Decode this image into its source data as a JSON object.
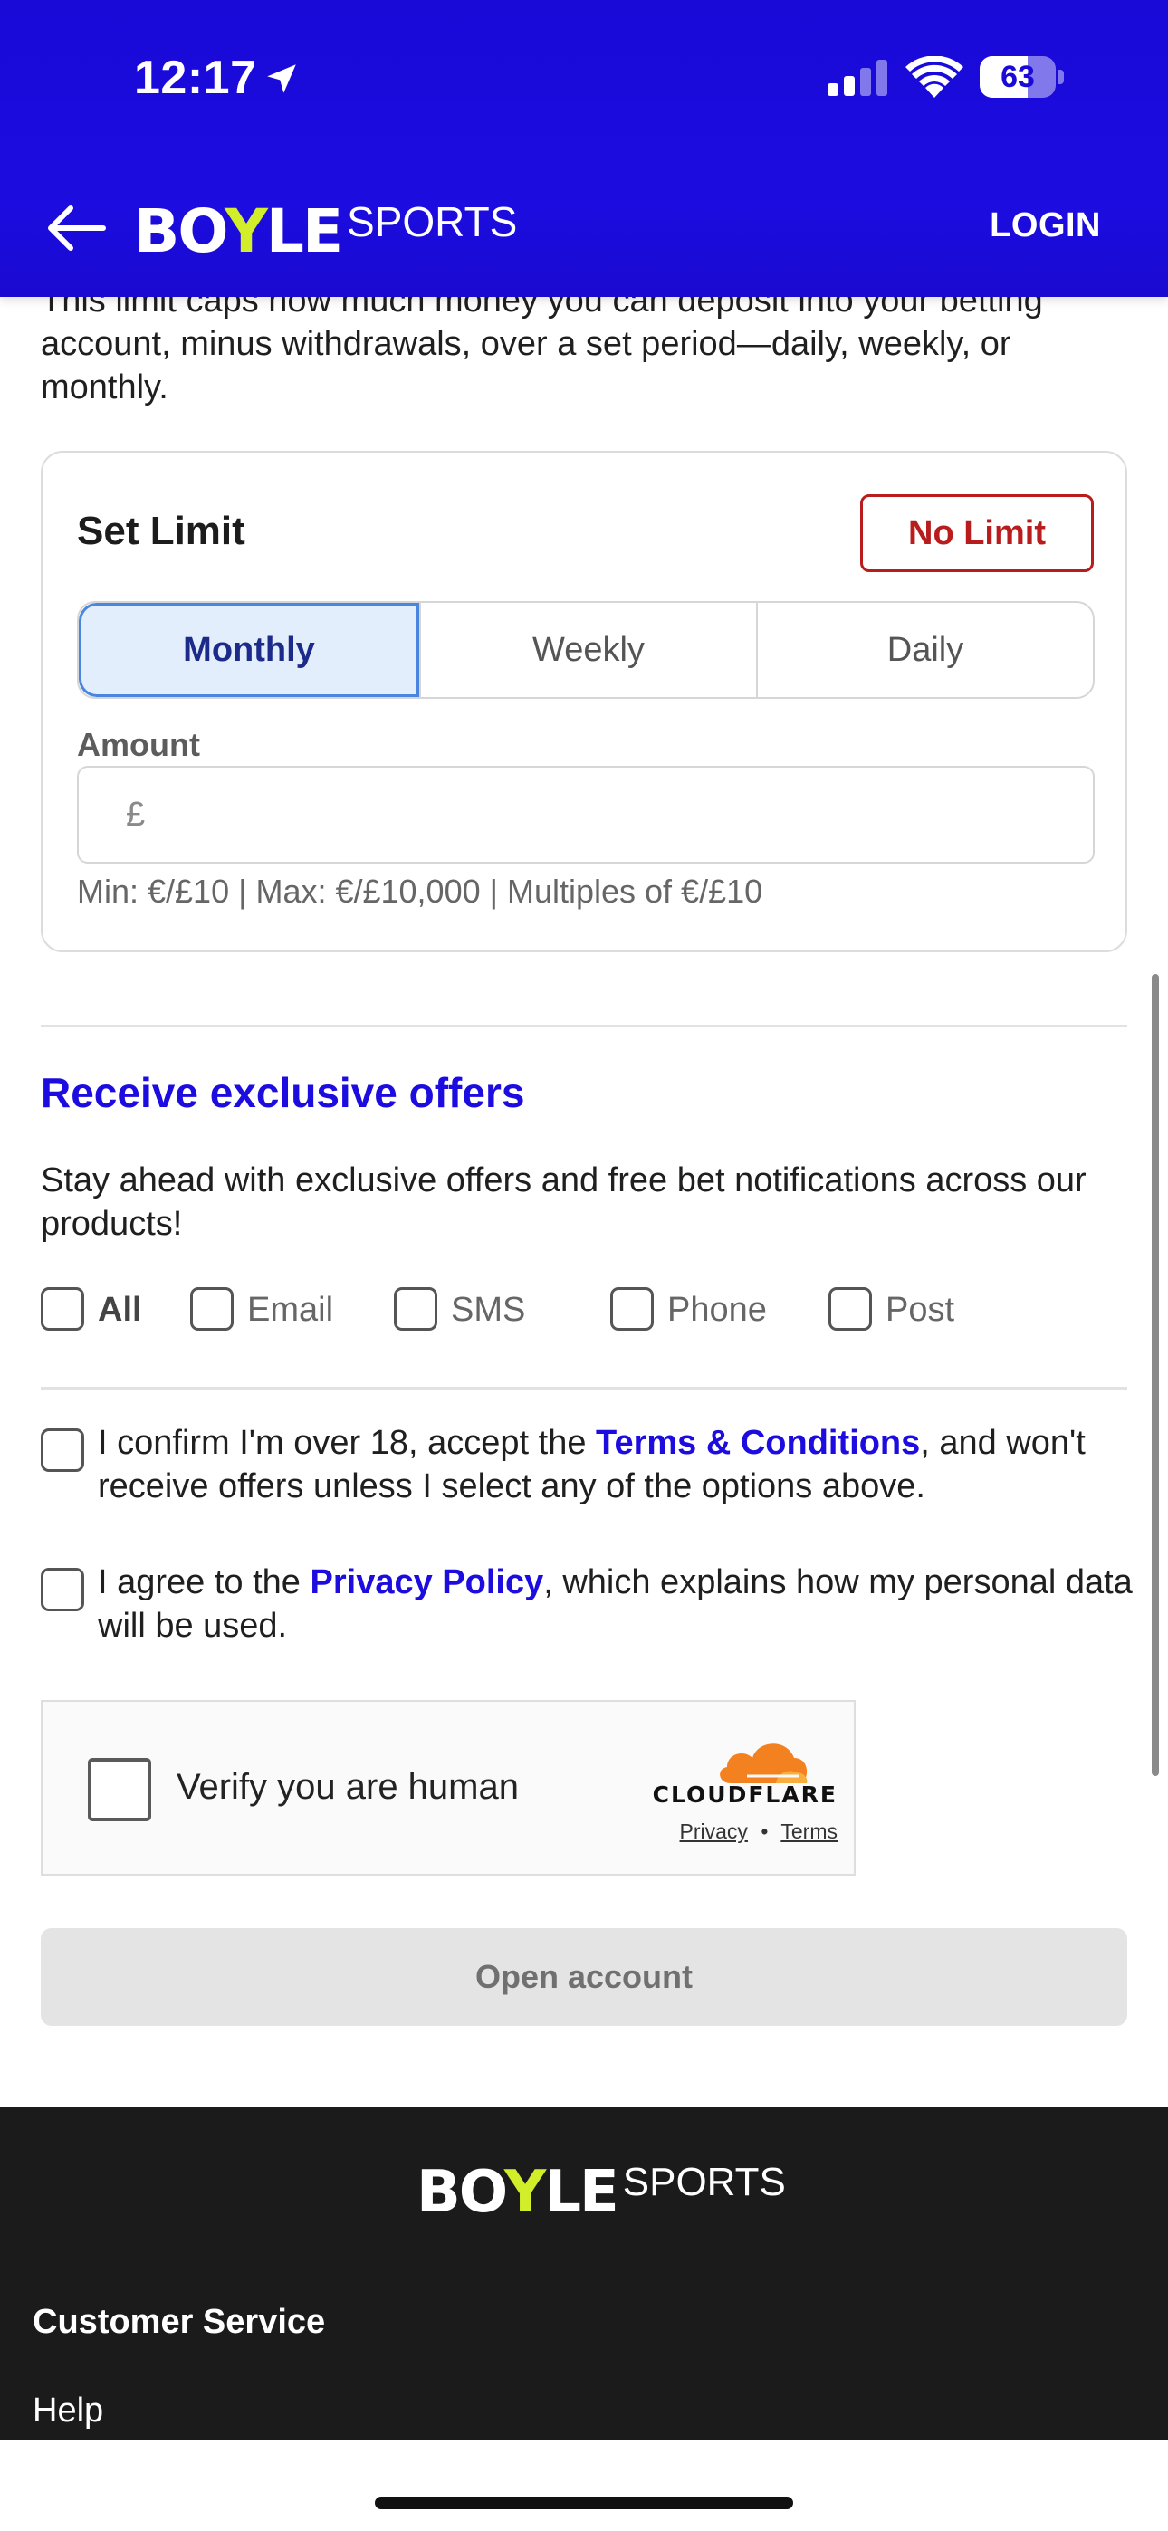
{
  "status_bar": {
    "time": "12:17",
    "battery_percent": "63",
    "battery_level": 0.63,
    "signal_bars": 4,
    "signal_active_bars": 2
  },
  "header": {
    "brand_main": "BOYLE",
    "brand_sub": "SPORTS",
    "login_label": "LOGIN",
    "bg_color": "#1c0cdf",
    "accent_color": "#d2ed2a"
  },
  "intro_text": "This limit caps how much money you can deposit into your betting account, minus withdrawals, over a set period—daily, weekly, or monthly.",
  "limit_card": {
    "title": "Set Limit",
    "no_limit_label": "No Limit",
    "periods": [
      "Monthly",
      "Weekly",
      "Daily"
    ],
    "selected_period": "Monthly",
    "amount_label": "Amount",
    "currency_symbol": "£",
    "amount_value": "",
    "hint": "Min: €/£10 | Max: €/£10,000 | Multiples of €/£10"
  },
  "offers": {
    "title": "Receive exclusive offers",
    "text": "Stay ahead with exclusive offers and free bet notifications across our products!",
    "options": [
      "All",
      "Email",
      "SMS",
      "Phone",
      "Post"
    ]
  },
  "consent": {
    "age_prefix": "I confirm I'm over 18, accept the ",
    "age_link": "Terms & Conditions",
    "age_suffix": ", and won't receive offers unless I select any of the options above.",
    "privacy_prefix": "I agree to the ",
    "privacy_link": "Privacy Policy",
    "privacy_suffix": ", which explains how my personal data will be used."
  },
  "captcha": {
    "label": "Verify you are human",
    "provider": "CLOUDFLARE",
    "privacy_link": "Privacy",
    "separator": "•",
    "terms_link": "Terms"
  },
  "open_account_label": "Open account",
  "footer": {
    "brand_main": "BOYLE",
    "brand_sub": "SPORTS",
    "section_heading": "Customer Service",
    "help_link": "Help"
  }
}
